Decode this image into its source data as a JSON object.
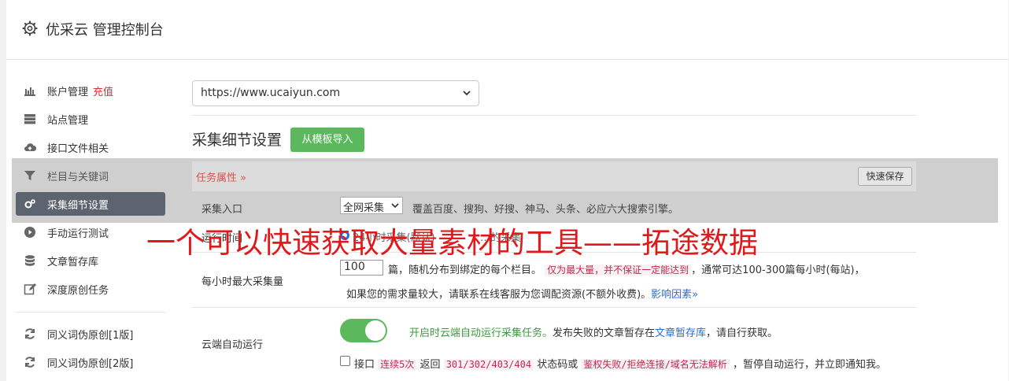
{
  "header": {
    "title": "优采云 管理控制台"
  },
  "sidebar": {
    "items": [
      {
        "label": "账户管理",
        "extra": "充值",
        "icon": "bar-chart-icon"
      },
      {
        "label": "站点管理",
        "icon": "server-icon"
      },
      {
        "label": "接口文件相关",
        "icon": "cloud-upload-icon"
      },
      {
        "label": "栏目与关键词",
        "icon": "filter-icon"
      },
      {
        "label": "采集细节设置",
        "icon": "gears-icon",
        "active": true
      },
      {
        "label": "手动运行测试",
        "icon": "play-circle-icon"
      },
      {
        "label": "文章暂存库",
        "icon": "database-icon"
      },
      {
        "label": "深度原创任务",
        "icon": "edit-icon"
      },
      {
        "label": "同义词伪原创[1版]",
        "icon": "refresh-icon"
      },
      {
        "label": "同义词伪原创[2版]",
        "icon": "refresh-icon"
      }
    ]
  },
  "site_select": {
    "value": "https://www.ucaiyun.com"
  },
  "section": {
    "title": "采集细节设置",
    "import_button": "从模板导入"
  },
  "tab": {
    "label": "任务属性 »",
    "save_button": "快速保存"
  },
  "rows": {
    "entry": {
      "label": "采集入口",
      "select_value": "全网采集",
      "desc": "覆盖百度、搜狗、好搜、神马、头条、必应六大搜索引擎。"
    },
    "runtime": {
      "label": "运行时间",
      "option": "24小时采集(默认)",
      "tail": "…的采集"
    },
    "max_per_hour": {
      "label": "每小时最大采集量",
      "value": "100",
      "desc_a": "篇，随机分布到绑定的每个栏目。",
      "code": "仅为最大量，并不保证一定能达到",
      "desc_b": "，通常可达100-300篇每小时(每站)，",
      "desc_c": "如果您的需求量较大，请联系在线客服为您调配资源(不额外收费)。",
      "link": "影响因素»"
    },
    "cloud_run": {
      "label": "云端自动运行",
      "green_text": "开启时云端自动运行采集任务。",
      "desc_a": "发布失败的文章暂存在",
      "link": "文章暂存库",
      "desc_b": "，请自行获取。",
      "chk_a": "接口",
      "code_a": "连续5次",
      "chk_b": "返回",
      "code_b": "301/302/403/404",
      "chk_c": "状态码或",
      "code_c": "鉴权失败/拒绝连接/域名无法解析",
      "chk_d": "，暂停自动运行，并立即通知我。"
    }
  },
  "watermark": "一个可以快速获取大量素材的工具——拓途数据",
  "colors": {
    "active_bg": "#5c6470",
    "green": "#5cb85c",
    "accent_red": "#d9302b",
    "watermark": "#e0191c"
  }
}
